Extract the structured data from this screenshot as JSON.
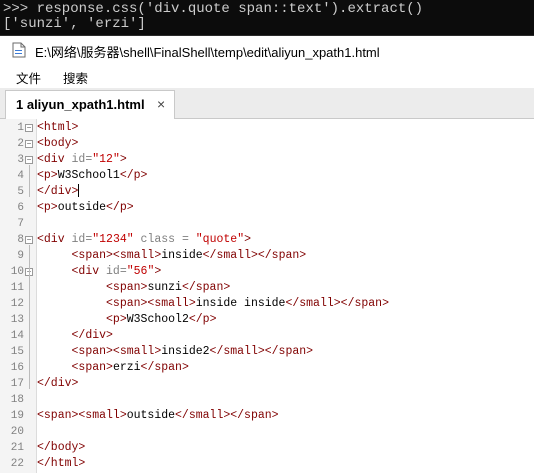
{
  "console": {
    "line1": ">>> response.css('div.quote span::text').extract()",
    "line2": "['sunzi', 'erzi']"
  },
  "window": {
    "title": "E:\\网络\\服务器\\shell\\FinalShell\\temp\\edit\\aliyun_xpath1.html"
  },
  "menu": {
    "file": "文件",
    "search": "搜索"
  },
  "tab": {
    "label": "1 aliyun_xpath1.html",
    "close": "×"
  },
  "editor": {
    "lines": [
      {
        "n": "1",
        "fold": "−",
        "tokens": [
          [
            "tg",
            "<html>"
          ]
        ]
      },
      {
        "n": "2",
        "fold": "−",
        "tokens": [
          [
            "tg",
            "<body>"
          ]
        ]
      },
      {
        "n": "3",
        "fold": "−",
        "tokens": [
          [
            "tg",
            "<div "
          ],
          [
            "at",
            "id="
          ],
          [
            "st",
            "\"12\""
          ],
          [
            "tg",
            ">"
          ]
        ]
      },
      {
        "n": "4",
        "fold": "",
        "tokens": [
          [
            "tg",
            "<p>"
          ],
          [
            "tx",
            "W3School1"
          ],
          [
            "tg",
            "</p>"
          ]
        ]
      },
      {
        "n": "5",
        "fold": "",
        "tokens": [
          [
            "tg",
            "</div>"
          ]
        ],
        "cursor": true
      },
      {
        "n": "6",
        "fold": "",
        "tokens": [
          [
            "tg",
            "<p>"
          ],
          [
            "tx",
            "outside"
          ],
          [
            "tg",
            "</p>"
          ]
        ]
      },
      {
        "n": "7",
        "fold": "",
        "tokens": []
      },
      {
        "n": "8",
        "fold": "−",
        "tokens": [
          [
            "tg",
            "<div "
          ],
          [
            "at",
            "id="
          ],
          [
            "st",
            "\"1234\""
          ],
          [
            "at",
            " class = "
          ],
          [
            "st",
            "\"quote\""
          ],
          [
            "tg",
            ">"
          ]
        ]
      },
      {
        "n": "9",
        "fold": "",
        "tokens": [
          [
            "tx",
            "     "
          ],
          [
            "tg",
            "<span><small>"
          ],
          [
            "tx",
            "inside"
          ],
          [
            "tg",
            "</small></span>"
          ]
        ]
      },
      {
        "n": "10",
        "fold": "−",
        "tokens": [
          [
            "tx",
            "     "
          ],
          [
            "tg",
            "<div "
          ],
          [
            "at",
            "id="
          ],
          [
            "st",
            "\"56\""
          ],
          [
            "tg",
            ">"
          ]
        ]
      },
      {
        "n": "11",
        "fold": "",
        "tokens": [
          [
            "tx",
            "          "
          ],
          [
            "tg",
            "<span>"
          ],
          [
            "tx",
            "sunzi"
          ],
          [
            "tg",
            "</span>"
          ]
        ]
      },
      {
        "n": "12",
        "fold": "",
        "tokens": [
          [
            "tx",
            "          "
          ],
          [
            "tg",
            "<span><small>"
          ],
          [
            "tx",
            "inside inside"
          ],
          [
            "tg",
            "</small></span>"
          ]
        ]
      },
      {
        "n": "13",
        "fold": "",
        "tokens": [
          [
            "tx",
            "          "
          ],
          [
            "tg",
            "<p>"
          ],
          [
            "tx",
            "W3School2"
          ],
          [
            "tg",
            "</p>"
          ]
        ]
      },
      {
        "n": "14",
        "fold": "",
        "tokens": [
          [
            "tx",
            "     "
          ],
          [
            "tg",
            "</div>"
          ]
        ]
      },
      {
        "n": "15",
        "fold": "",
        "tokens": [
          [
            "tx",
            "     "
          ],
          [
            "tg",
            "<span><small>"
          ],
          [
            "tx",
            "inside2"
          ],
          [
            "tg",
            "</small></span>"
          ]
        ]
      },
      {
        "n": "16",
        "fold": "",
        "tokens": [
          [
            "tx",
            "     "
          ],
          [
            "tg",
            "<span>"
          ],
          [
            "tx",
            "erzi"
          ],
          [
            "tg",
            "</span>"
          ]
        ]
      },
      {
        "n": "17",
        "fold": "",
        "tokens": [
          [
            "tg",
            "</div>"
          ]
        ]
      },
      {
        "n": "18",
        "fold": "",
        "tokens": []
      },
      {
        "n": "19",
        "fold": "",
        "tokens": [
          [
            "tg",
            "<span><small>"
          ],
          [
            "tx",
            "outside"
          ],
          [
            "tg",
            "</small></span>"
          ]
        ]
      },
      {
        "n": "20",
        "fold": "",
        "tokens": []
      },
      {
        "n": "21",
        "fold": "",
        "tokens": [
          [
            "tg",
            "</body>"
          ]
        ]
      },
      {
        "n": "22",
        "fold": "",
        "tokens": [
          [
            "tg",
            "</html>"
          ]
        ]
      }
    ]
  }
}
